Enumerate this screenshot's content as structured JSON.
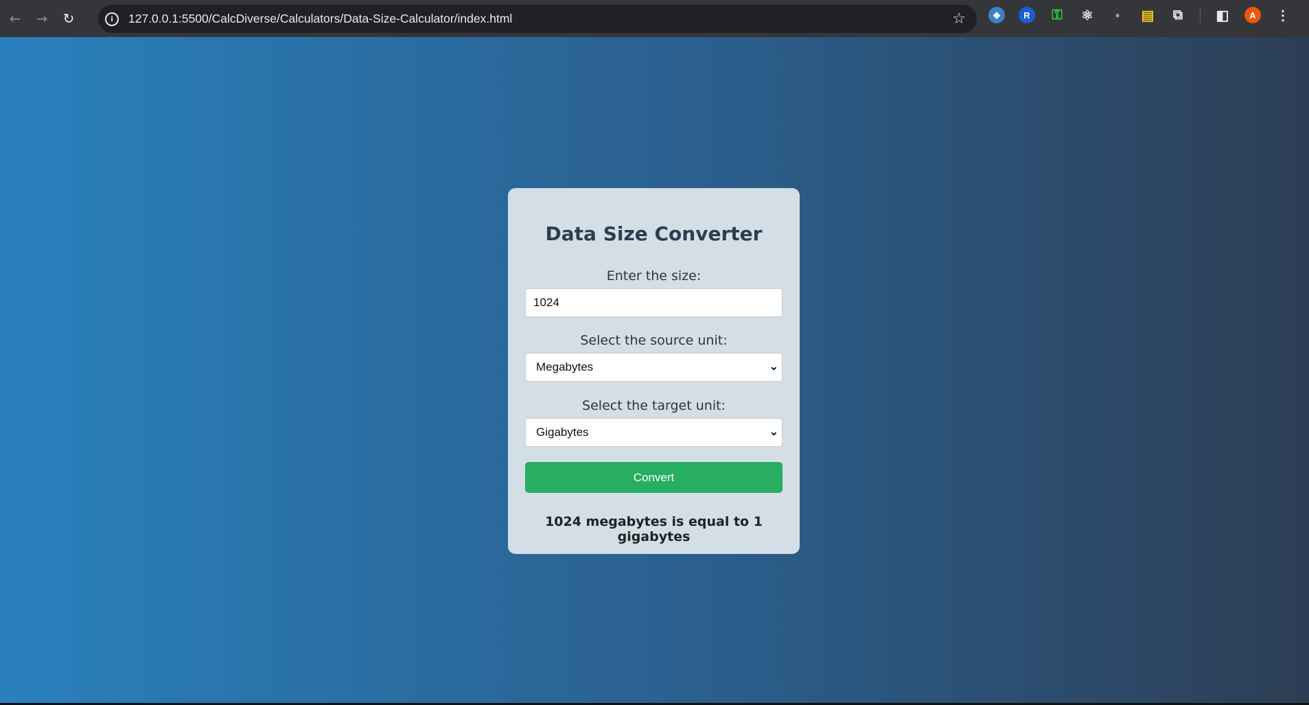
{
  "browser": {
    "url": "127.0.0.1:5500/CalcDiverse/Calculators/Data-Size-Calculator/index.html",
    "back_glyph": "←",
    "forward_glyph": "→",
    "reload_glyph": "↻",
    "info_glyph": "i",
    "star_glyph": "☆",
    "menu_glyph": "⋮",
    "extensions": [
      {
        "name": "shield-extension-icon",
        "glyph": "◆",
        "color": "#3b82c4"
      },
      {
        "name": "r-extension-icon",
        "glyph": "R",
        "color": "#1a5fd0"
      },
      {
        "name": "lock-extension-icon",
        "glyph": "⚿",
        "color": "#2ecc40"
      },
      {
        "name": "react-extension-icon",
        "glyph": "⚛",
        "color": "#35363a"
      },
      {
        "name": "figure-extension-icon",
        "glyph": "●",
        "color": "#35363a"
      },
      {
        "name": "folder-extension-icon",
        "glyph": "▤",
        "color": "#f5c518"
      },
      {
        "name": "puzzle-extensions-icon",
        "glyph": "⧉",
        "color": "#35363a"
      }
    ],
    "profile_initial": "A",
    "profile_color": "#e8590c",
    "sidebar_glyph": "◧"
  },
  "converter": {
    "title": "Data Size Converter",
    "size_label": "Enter the size:",
    "size_value": "1024",
    "source_label": "Select the source unit:",
    "source_value": "Megabytes",
    "target_label": "Select the target unit:",
    "target_value": "Gigabytes",
    "convert_label": "Convert",
    "result": "1024 megabytes is equal to 1 gigabytes",
    "chevron_glyph": "⌄"
  },
  "colors": {
    "convert_button": "#27ae60",
    "card_background": "#d3dee6",
    "title_color": "#2c3e50"
  }
}
